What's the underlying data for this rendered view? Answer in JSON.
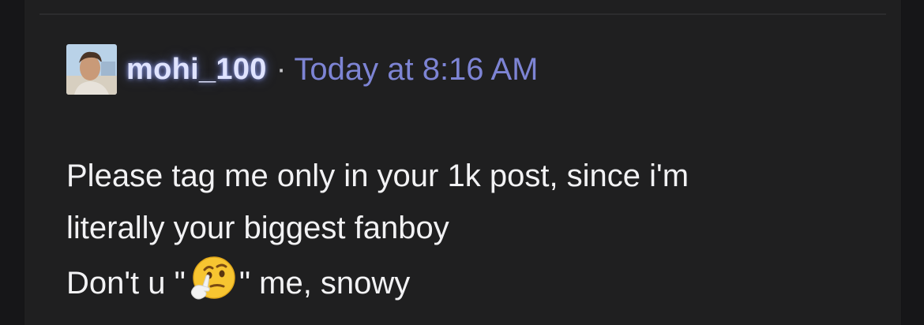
{
  "comment": {
    "username": "mohi_100",
    "separator": "·",
    "timestamp": "Today at 8:16 AM",
    "message_lines": [
      "Please tag me only in your 1k post, since i'm",
      "literally your biggest fanboy"
    ],
    "message_last_prefix": "Don't u \"",
    "message_last_emoji": "thinking-face-emoji",
    "message_last_suffix": "\" me, snowy"
  },
  "colors": {
    "background": "#1f1f20",
    "username": "#dfe3ff",
    "timestamp": "#7d84d4",
    "message": "#f2f2f4"
  }
}
